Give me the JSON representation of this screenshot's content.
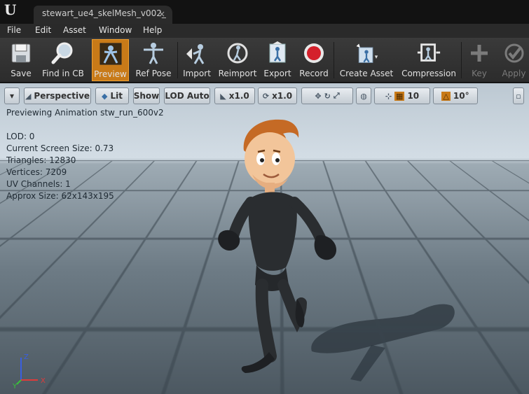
{
  "window": {
    "logo": "U",
    "tab_title": "stewart_ue4_skelMesh_v002_",
    "tab_close": "×"
  },
  "menu": {
    "items": [
      "File",
      "Edit",
      "Asset",
      "Window",
      "Help"
    ]
  },
  "toolbar": {
    "buttons": [
      {
        "label": "Save",
        "icon": "save-icon"
      },
      {
        "label": "Find in CB",
        "icon": "magnifier-icon"
      },
      {
        "label": "Preview",
        "icon": "preview-icon",
        "active": true
      },
      {
        "label": "Ref Pose",
        "icon": "ref-pose-icon"
      },
      {
        "label": "Import",
        "icon": "import-icon"
      },
      {
        "label": "Reimport",
        "icon": "reimport-icon"
      },
      {
        "label": "Export",
        "icon": "export-icon"
      },
      {
        "label": "Record",
        "icon": "record-icon"
      },
      {
        "label": "Create Asset",
        "icon": "create-asset-icon"
      },
      {
        "label": "Compression",
        "icon": "compression-icon"
      },
      {
        "label": "Key",
        "icon": "plus-icon",
        "disabled": true
      },
      {
        "label": "Apply",
        "icon": "check-icon",
        "disabled": true
      }
    ],
    "accent_color": "#c87a18"
  },
  "viewport_toolbar": {
    "dropdown": "▾",
    "perspective": "Perspective",
    "lit": "Lit",
    "show": "Show",
    "lod": "LOD Auto",
    "speed_1": "x1.0",
    "speed_2": "x1.0",
    "grid_snap": "10",
    "rotate_snap": "10°"
  },
  "stats": {
    "heading": "Previewing Animation stw_run_600v2",
    "lod": "LOD: 0",
    "screen_size": "Current Screen Size: 0.73",
    "triangles": "Triangles: 12830",
    "vertices": "Vertices: 7209",
    "uv_channels": "UV Channels: 1",
    "approx_size": "Approx Size: 62x143x195"
  },
  "axis": {
    "x": "X",
    "y": "Y",
    "z": "Z"
  }
}
